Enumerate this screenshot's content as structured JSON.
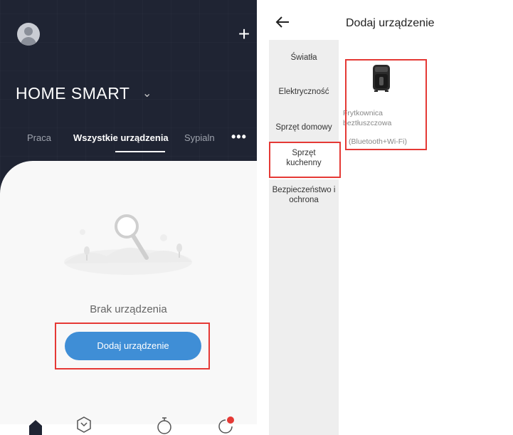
{
  "left_screen": {
    "home_title": "HOME SMART",
    "home_chevron": "⌄",
    "plus_icon": "+",
    "tabs": [
      {
        "label": "Praca"
      },
      {
        "label": "Wszystkie urządzenia"
      },
      {
        "label": "Sypialn"
      }
    ],
    "more_icon": "•••",
    "empty_text": "Brak urządzenia",
    "add_button_label": "Dodaj urządzenie",
    "nav_icons": [
      "home-icon",
      "cube-icon",
      "timer-icon",
      "profile-icon"
    ],
    "colors": {
      "header_bg": "#1f2433",
      "button": "#3f8ed6",
      "highlight": "#e53935",
      "badge": "#e53935"
    }
  },
  "right_screen": {
    "title": "Dodaj urządzenie",
    "back_icon": "arrow-left-icon",
    "categories": [
      {
        "label": "Światła"
      },
      {
        "label": "Elektryczność"
      },
      {
        "label": "Sprzęt domowy"
      },
      {
        "label": "Sprzęt kuchenny"
      },
      {
        "label": "Bezpieczeństwo i ochrona"
      }
    ],
    "device": {
      "name_line1": "Frytkownica",
      "name_line2": "beztłuszczowa",
      "connectivity": "(Bluetooth+Wi-Fi)"
    }
  }
}
